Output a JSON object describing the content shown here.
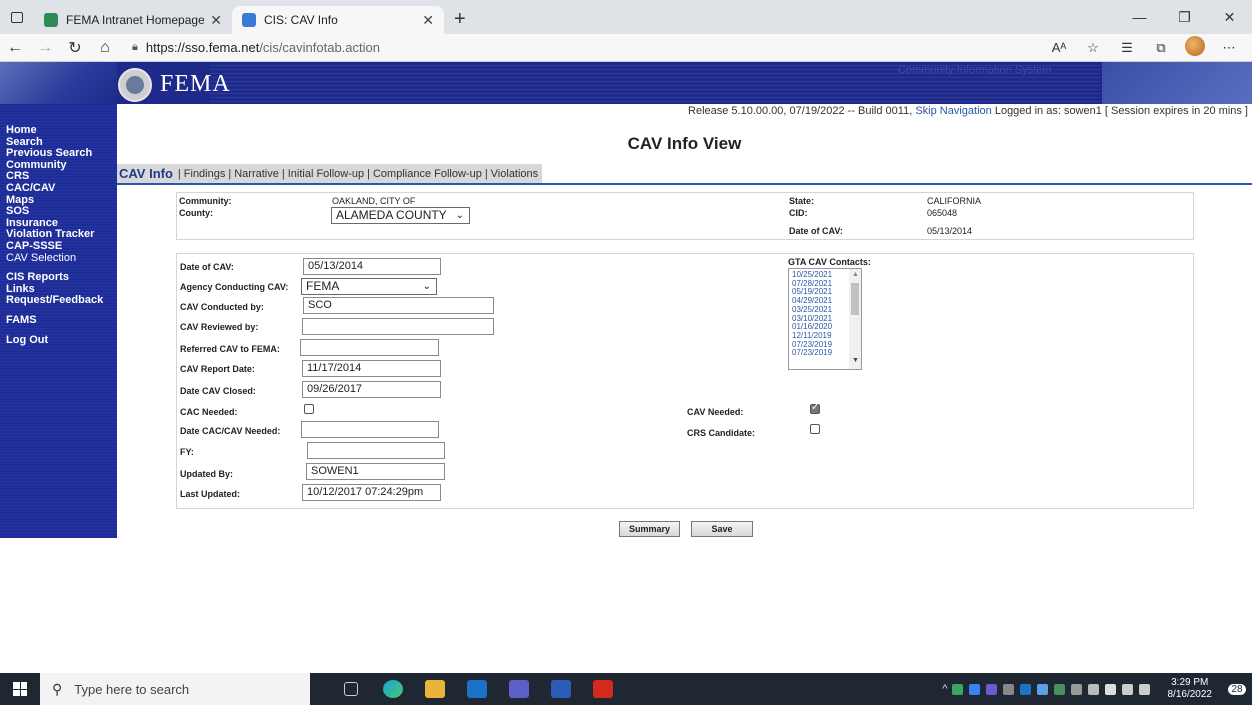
{
  "browser": {
    "tabs": [
      {
        "title": "FEMA Intranet Homepage",
        "active": false
      },
      {
        "title": "CIS: CAV Info",
        "active": true
      }
    ],
    "url_host": "https://sso.fema.net",
    "url_path": "/cis/cavinfotab.action",
    "read_aloud": "Aᴬ"
  },
  "header": {
    "logo_text": "FEMA",
    "system_name": "Community Information System"
  },
  "leftnav": {
    "items": [
      {
        "label": "Home"
      },
      {
        "label": "Search"
      },
      {
        "label": "Previous Search"
      },
      {
        "label": "Community"
      },
      {
        "label": "CRS"
      },
      {
        "label": "CAC/CAV"
      },
      {
        "label": "Maps"
      },
      {
        "label": "SOS"
      },
      {
        "label": "Insurance"
      },
      {
        "label": "Violation Tracker"
      },
      {
        "label": "CAP-SSSE"
      },
      {
        "label": "CAV Selection"
      },
      {
        "label": "CIS Reports"
      },
      {
        "label": "Links"
      },
      {
        "label": "Request/Feedback"
      },
      {
        "label": "FAMS"
      },
      {
        "label": "Log Out"
      }
    ]
  },
  "status": {
    "release": "Release 5.10.00.00, 07/19/2022 -- Build 0011,",
    "skip_nav": "Skip Navigation",
    "logged_in": "Logged in as: sowen1",
    "session": "[ Session expires in 20 mins ]"
  },
  "page": {
    "title": "CAV Info View",
    "tabs": {
      "current": "CAV Info",
      "others": [
        "Findings",
        "Narrative",
        "Initial Follow-up",
        "Compliance Follow-up",
        "Violations"
      ]
    }
  },
  "summary": {
    "community_label": "Community:",
    "community_value": "OAKLAND, CITY OF",
    "county_label": "County:",
    "county_value": "ALAMEDA COUNTY",
    "state_label": "State:",
    "state_value": "CALIFORNIA",
    "cid_label": "CID:",
    "cid_value": "065048",
    "date_label": "Date of CAV:",
    "date_value": "05/13/2014"
  },
  "form": {
    "date_of_cav": {
      "label": "Date of CAV:",
      "value": "05/13/2014"
    },
    "agency": {
      "label": "Agency Conducting CAV:",
      "value": "FEMA"
    },
    "conducted_by": {
      "label": "CAV Conducted by:",
      "value": "SCO"
    },
    "reviewed_by": {
      "label": "CAV Reviewed by:",
      "value": ""
    },
    "referred": {
      "label": "Referred CAV to FEMA:",
      "value": ""
    },
    "report_date": {
      "label": "CAV Report Date:",
      "value": "11/17/2014"
    },
    "date_closed": {
      "label": "Date CAV Closed:",
      "value": "09/26/2017"
    },
    "cac_needed": {
      "label": "CAC Needed:",
      "checked": false
    },
    "cav_needed": {
      "label": "CAV Needed:",
      "checked": true
    },
    "date_cac_cav_needed": {
      "label": "Date CAC/CAV Needed:",
      "value": ""
    },
    "crs_candidate": {
      "label": "CRS Candidate:",
      "checked": false
    },
    "fy": {
      "label": "FY:",
      "value": ""
    },
    "updated_by": {
      "label": "Updated By:",
      "value": "SOWEN1"
    },
    "last_updated": {
      "label": "Last Updated:",
      "value": "10/12/2017 07:24:29pm"
    },
    "gta_label": "GTA CAV Contacts:",
    "gta_contacts": [
      "10/25/2021",
      "07/28/2021",
      "05/19/2021",
      "04/29/2021",
      "03/25/2021",
      "03/10/2021",
      "01/16/2020",
      "12/11/2019",
      "07/23/2019",
      "07/23/2019"
    ]
  },
  "buttons": {
    "summary": "Summary",
    "save": "Save"
  },
  "taskbar": {
    "search_placeholder": "Type here to search",
    "time": "3:29 PM",
    "date": "8/16/2022",
    "notifications": "28"
  }
}
